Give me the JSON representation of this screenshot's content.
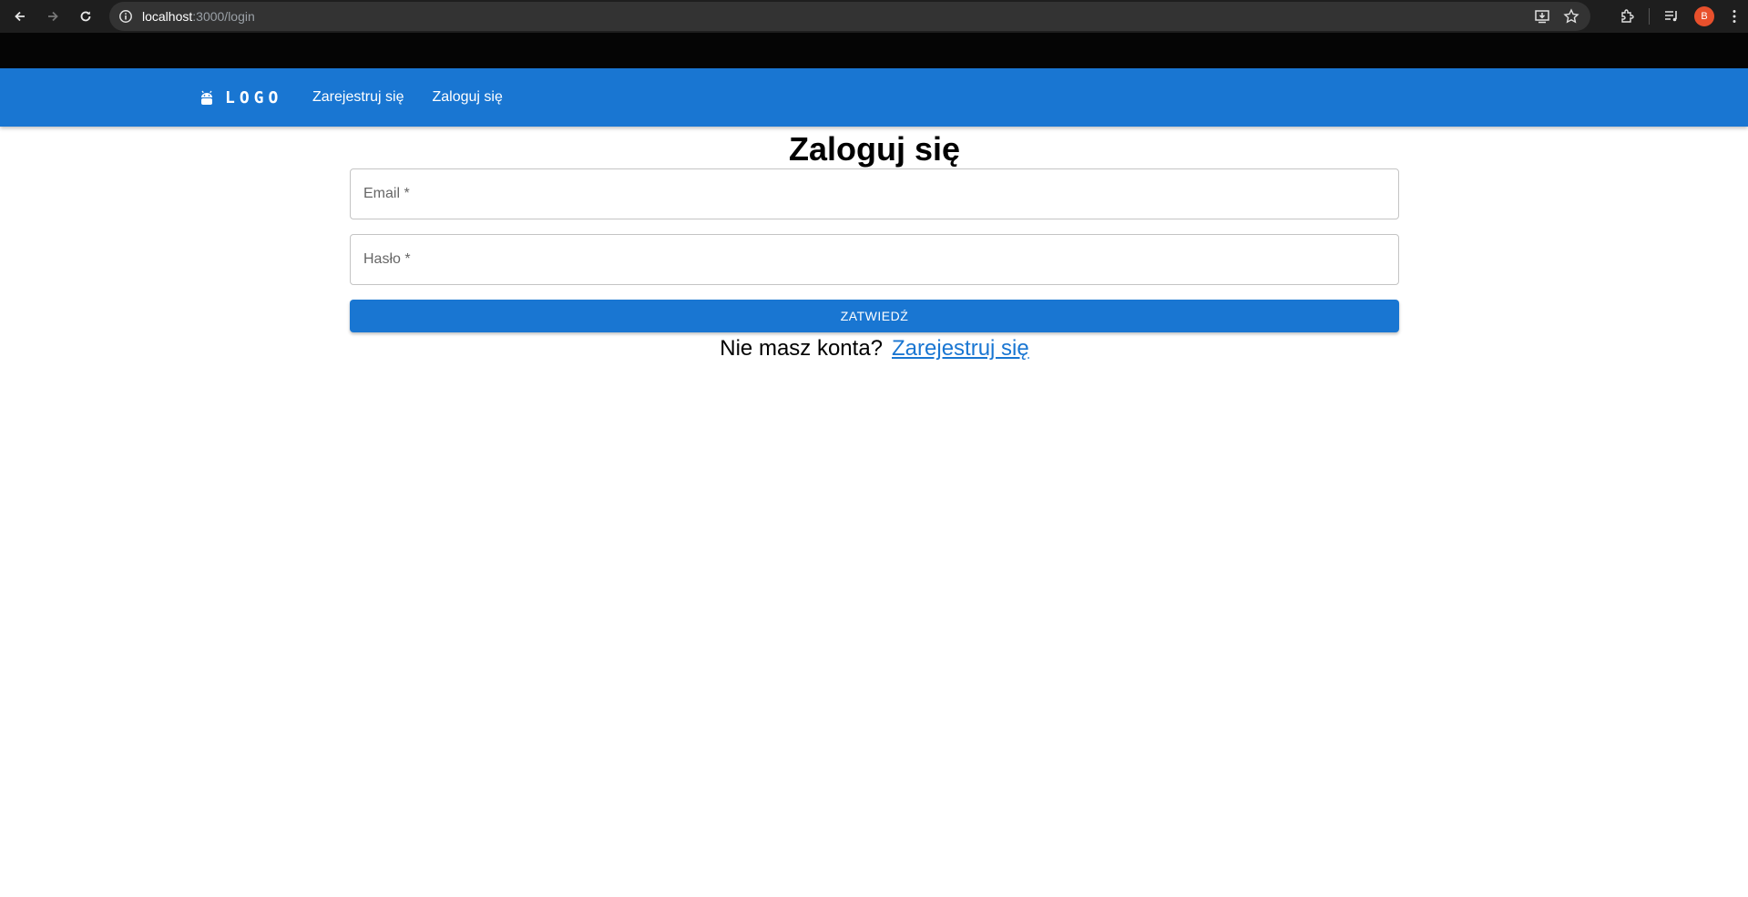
{
  "browser": {
    "url_host": "localhost",
    "url_path": ":3000/login",
    "profile_initial": "B"
  },
  "appbar": {
    "logo_text": "LOGO",
    "nav": [
      {
        "label": "Zarejestruj się"
      },
      {
        "label": "Zaloguj się"
      }
    ]
  },
  "login": {
    "title": "Zaloguj się",
    "email_placeholder": "Email *",
    "password_placeholder": "Hasło *",
    "submit_label": "ZATWIEDŹ",
    "no_account_text": "Nie masz konta?",
    "register_link": "Zarejestruj się"
  },
  "colors": {
    "primary": "#1976d2",
    "chrome_bg": "#1e1e1e",
    "avatar": "#e8502c"
  }
}
